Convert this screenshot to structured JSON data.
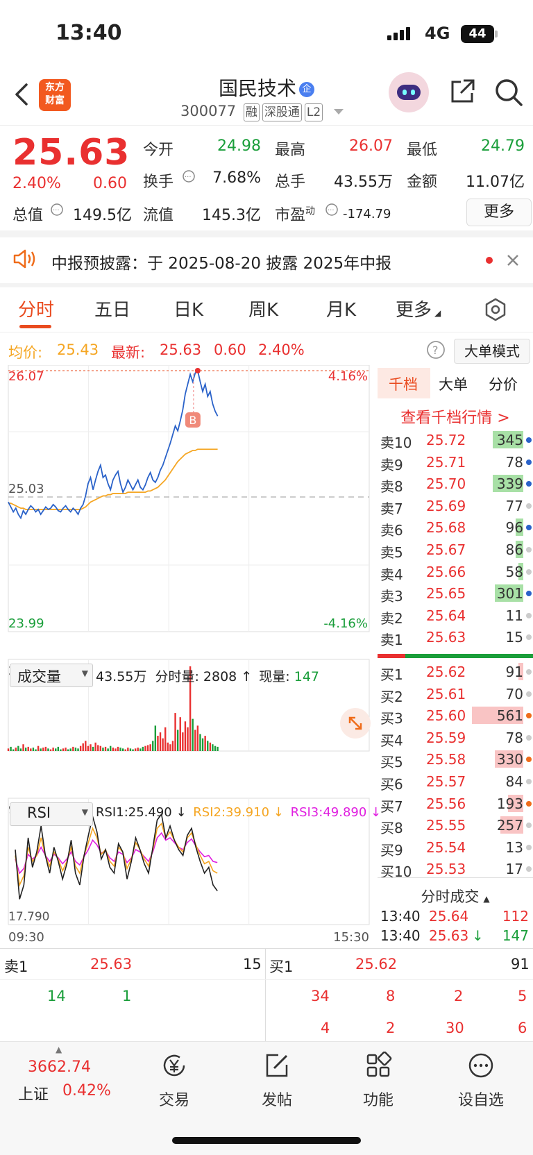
{
  "status_bar": {
    "time": "13:40",
    "network": "4G",
    "battery": "44"
  },
  "header": {
    "logo_text": "东方财富",
    "stock_name": "国民技术",
    "qi_badge": "企",
    "stock_code": "300077",
    "tags": [
      "融",
      "深股通",
      "L2"
    ]
  },
  "quote": {
    "price": "25.63",
    "change_pct": "2.40%",
    "change": "0.60",
    "rows": [
      [
        {
          "label": "今开",
          "value": "24.98",
          "color": "green"
        },
        {
          "label": "最高",
          "value": "26.07",
          "color": "red"
        },
        {
          "label": "最低",
          "value": "24.79",
          "color": "green"
        }
      ],
      [
        {
          "label": "换手",
          "value": "7.68%",
          "color": "black"
        },
        {
          "label": "总手",
          "value": "43.55万",
          "color": "black"
        },
        {
          "label": "金额",
          "value": "11.07亿",
          "color": "black"
        }
      ],
      [
        {
          "label": "总值",
          "value": "149.5亿",
          "color": "black"
        },
        {
          "label": "流值",
          "value": "145.3亿",
          "color": "black"
        },
        {
          "label": "市盈",
          "sup": "动",
          "value": "-174.79",
          "color": "black"
        }
      ]
    ],
    "more_label": "更多"
  },
  "notice": {
    "text": "中报预披露：于 2025-08-20 披露 2025年中报"
  },
  "chart_tabs": [
    "分时",
    "五日",
    "日K",
    "周K",
    "月K",
    "更多"
  ],
  "info_bar": {
    "avg_label": "均价:",
    "avg_value": "25.43",
    "latest_label": "最新:",
    "latest_value": "25.63",
    "latest_change": "0.60",
    "latest_pct": "2.40%",
    "big_order_mode": "大单模式"
  },
  "chart_data": [
    {
      "type": "line",
      "title": "分时",
      "y_top_label": "26.07",
      "y_mid_label": "25.03",
      "y_bottom_label": "23.99",
      "pct_top_label": "4.16%",
      "pct_bottom_label": "-4.16%",
      "x_start_label": "09:30",
      "x_end_label": "15:30",
      "ylim": [
        23.99,
        26.07
      ],
      "prev_close": 25.03,
      "series": [
        {
          "color": "#2a62c9",
          "values": [
            25.0,
            24.96,
            24.92,
            24.95,
            24.9,
            24.87,
            24.93,
            24.9,
            24.94,
            24.97,
            24.95,
            24.92,
            24.94,
            24.9,
            24.93,
            24.96,
            24.94,
            24.95,
            24.98,
            24.96,
            24.93,
            24.92,
            24.95,
            24.97,
            24.94,
            24.92,
            24.95,
            24.93,
            24.9,
            24.95,
            24.98,
            25.05,
            25.15,
            25.2,
            25.1,
            25.18,
            25.25,
            25.3,
            25.2,
            25.22,
            25.15,
            25.1,
            25.18,
            25.22,
            25.25,
            25.15,
            25.08,
            25.12,
            25.18,
            25.14,
            25.1,
            25.14,
            25.18,
            25.12,
            25.1,
            25.14,
            25.2,
            25.24,
            25.18,
            25.16,
            25.2,
            25.26,
            25.3,
            25.36,
            25.42,
            25.48,
            25.55,
            25.62,
            25.58,
            25.66,
            25.75,
            25.88,
            25.96,
            26.04,
            25.98,
            26.05,
            26.07,
            25.98,
            25.9,
            25.96,
            25.86,
            25.9,
            25.8,
            25.74,
            25.7
          ],
          "name": ""
        },
        {
          "color": "#f5a623",
          "values": [
            24.99,
            24.99,
            24.98,
            24.97,
            24.96,
            24.95,
            24.95,
            24.94,
            24.94,
            24.94,
            24.94,
            24.94,
            24.94,
            24.94,
            24.94,
            24.94,
            24.94,
            24.94,
            24.94,
            24.94,
            24.94,
            24.94,
            24.94,
            24.94,
            24.94,
            24.94,
            24.94,
            24.94,
            24.94,
            24.94,
            24.95,
            24.96,
            24.98,
            25.0,
            25.01,
            25.02,
            25.03,
            25.04,
            25.05,
            25.05,
            25.06,
            25.06,
            25.07,
            25.07,
            25.07,
            25.07,
            25.07,
            25.07,
            25.08,
            25.08,
            25.08,
            25.08,
            25.08,
            25.08,
            25.08,
            25.08,
            25.09,
            25.09,
            25.1,
            25.11,
            25.12,
            25.14,
            25.16,
            25.18,
            25.21,
            25.24,
            25.27,
            25.3,
            25.33,
            25.35,
            25.37,
            25.39,
            25.4,
            25.41,
            25.42,
            25.42,
            25.43,
            25.43,
            25.43,
            25.43,
            25.43,
            25.43,
            25.43,
            25.43,
            25.43
          ],
          "name": ""
        }
      ]
    },
    {
      "type": "bar",
      "title": "成交量",
      "ymax_label": "26326",
      "summary": "43.55万",
      "minute_vol_label": "分时量:",
      "minute_vol": "2808",
      "current_label": "现量:",
      "current": "147",
      "values": [
        3,
        5,
        2,
        4,
        6,
        3,
        8,
        4,
        5,
        3,
        4,
        2,
        6,
        3,
        4,
        5,
        3,
        2,
        4,
        3,
        5,
        2,
        3,
        4,
        2,
        3,
        5,
        4,
        3,
        6,
        9,
        12,
        6,
        8,
        5,
        10,
        7,
        6,
        4,
        5,
        3,
        6,
        4,
        3,
        5,
        4,
        3,
        2,
        4,
        3,
        2,
        3,
        4,
        3,
        5,
        6,
        7,
        8,
        12,
        30,
        18,
        22,
        15,
        28,
        10,
        8,
        12,
        45,
        25,
        40,
        22,
        35,
        28,
        100,
        38,
        25,
        30,
        20,
        15,
        18,
        12,
        10,
        8,
        6,
        5
      ],
      "colors_up": "#e93030",
      "colors_down": "#1a9e3a"
    },
    {
      "type": "line",
      "title": "RSI",
      "ymax_label": "90.240",
      "ymin_label": "17.790",
      "ylim": [
        17.79,
        90.24
      ],
      "legend": [
        {
          "label": "RSI1:25.490 ↓",
          "color": "#222"
        },
        {
          "label": "RSI2:39.910 ↓",
          "color": "#f5a623"
        },
        {
          "label": "RSI3:49.890 ↓",
          "color": "#e020e0"
        }
      ],
      "series": [
        {
          "name": "RSI1",
          "color": "#222",
          "values": [
            60,
            18,
            30,
            70,
            45,
            58,
            80,
            55,
            40,
            62,
            50,
            35,
            48,
            68,
            40,
            30,
            55,
            72,
            88,
            75,
            52,
            60,
            45,
            40,
            65,
            58,
            35,
            50,
            70,
            60,
            48,
            40,
            62,
            85,
            90,
            70,
            80,
            68,
            60,
            55,
            72,
            78,
            62,
            50,
            40,
            45,
            30,
            25
          ]
        },
        {
          "name": "RSI2",
          "color": "#f5a623",
          "values": [
            55,
            30,
            38,
            62,
            50,
            55,
            70,
            55,
            46,
            58,
            52,
            42,
            50,
            62,
            46,
            40,
            55,
            66,
            78,
            70,
            56,
            60,
            50,
            46,
            62,
            58,
            44,
            52,
            66,
            60,
            52,
            46,
            60,
            78,
            82,
            70,
            75,
            68,
            62,
            58,
            70,
            74,
            64,
            55,
            48,
            50,
            42,
            40
          ]
        },
        {
          "name": "RSI3",
          "color": "#e020e0",
          "values": [
            52,
            40,
            44,
            56,
            52,
            55,
            62,
            55,
            50,
            56,
            53,
            48,
            52,
            58,
            50,
            47,
            54,
            60,
            68,
            64,
            57,
            59,
            53,
            50,
            58,
            56,
            49,
            53,
            60,
            58,
            54,
            50,
            58,
            70,
            74,
            68,
            70,
            66,
            62,
            60,
            66,
            69,
            63,
            58,
            54,
            55,
            50,
            49
          ]
        }
      ]
    }
  ],
  "volume_selector": "成交量",
  "rsi_selector": "RSI",
  "orderbook": {
    "tabs": [
      "千档",
      "大单",
      "分价"
    ],
    "link": "查看千档行情 >",
    "asks": [
      {
        "label": "卖10",
        "price": "25.72",
        "vol": "345",
        "bar": 0.6,
        "dot": "#2a62c9"
      },
      {
        "label": "卖9",
        "price": "25.71",
        "vol": "78",
        "bar": 0,
        "dot": "#2a62c9"
      },
      {
        "label": "卖8",
        "price": "25.70",
        "vol": "339",
        "bar": 0.6,
        "dot": "#2a62c9"
      },
      {
        "label": "卖7",
        "price": "25.69",
        "vol": "77",
        "bar": 0,
        "dot": "#ccc"
      },
      {
        "label": "卖6",
        "price": "25.68",
        "vol": "96",
        "bar": 0.15,
        "dot": "#2a62c9"
      },
      {
        "label": "卖5",
        "price": "25.67",
        "vol": "86",
        "bar": 0.15,
        "dot": "#ccc"
      },
      {
        "label": "卖4",
        "price": "25.66",
        "vol": "58",
        "bar": 0.1,
        "dot": "#ccc"
      },
      {
        "label": "卖3",
        "price": "25.65",
        "vol": "301",
        "bar": 0.55,
        "dot": "#2a62c9"
      },
      {
        "label": "卖2",
        "price": "25.64",
        "vol": "11",
        "bar": 0,
        "dot": "#ccc"
      },
      {
        "label": "卖1",
        "price": "25.63",
        "vol": "15",
        "bar": 0,
        "dot": "#ccc"
      }
    ],
    "bids": [
      {
        "label": "买1",
        "price": "25.62",
        "vol": "91",
        "bar": 0.1,
        "dot": "#ccc"
      },
      {
        "label": "买2",
        "price": "25.61",
        "vol": "70",
        "bar": 0,
        "dot": "#ccc"
      },
      {
        "label": "买3",
        "price": "25.60",
        "vol": "561",
        "bar": 1.0,
        "dot": "#ef6c1a"
      },
      {
        "label": "买4",
        "price": "25.59",
        "vol": "78",
        "bar": 0,
        "dot": "#ccc"
      },
      {
        "label": "买5",
        "price": "25.58",
        "vol": "330",
        "bar": 0.55,
        "dot": "#ef6c1a"
      },
      {
        "label": "买6",
        "price": "25.57",
        "vol": "84",
        "bar": 0,
        "dot": "#ccc"
      },
      {
        "label": "买7",
        "price": "25.56",
        "vol": "193",
        "bar": 0.3,
        "dot": "#ef6c1a"
      },
      {
        "label": "买8",
        "price": "25.55",
        "vol": "257",
        "bar": 0.45,
        "dot": "#ccc"
      },
      {
        "label": "买9",
        "price": "25.54",
        "vol": "13",
        "bar": 0,
        "dot": "#ccc"
      },
      {
        "label": "买10",
        "price": "25.53",
        "vol": "17",
        "bar": 0,
        "dot": "#ccc"
      }
    ],
    "trades_title": "分时成交",
    "trades": [
      {
        "time": "13:40",
        "price": "25.64",
        "arrow": "",
        "vol": "112"
      },
      {
        "time": "13:40",
        "price": "25.63",
        "arrow": "↓",
        "vol": "147"
      }
    ]
  },
  "bottom_quote": {
    "sell": {
      "label": "卖1",
      "price": "25.63",
      "vol": "15",
      "queue": [
        "14",
        "1"
      ]
    },
    "buy": {
      "label": "买1",
      "price": "25.62",
      "vol": "91",
      "queue": [
        "34",
        "8",
        "2",
        "5",
        "4",
        "2",
        "30",
        "6"
      ]
    }
  },
  "tabbar": {
    "index_value": "3662.74",
    "index_name": "上证",
    "index_pct": "0.42%",
    "items": [
      "交易",
      "发帖",
      "功能",
      "设自选"
    ]
  }
}
